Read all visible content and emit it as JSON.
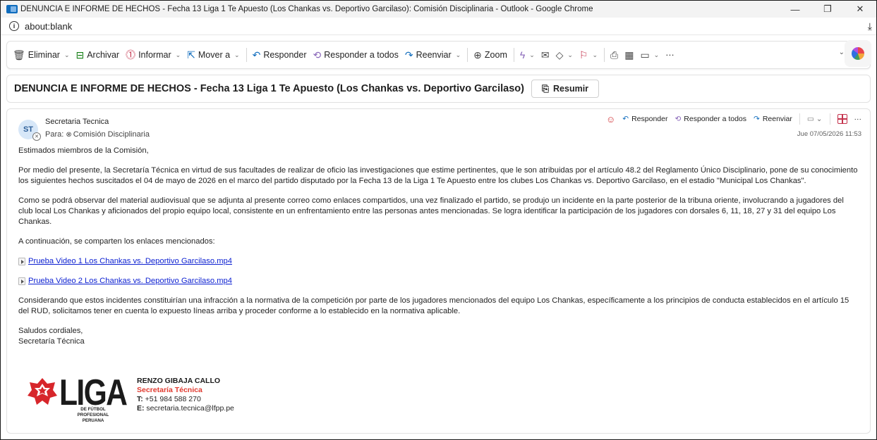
{
  "window": {
    "title": "DENUNCIA E INFORME DE HECHOS - Fecha 13 Liga 1 Te Apuesto (Los Chankas vs. Deportivo Garcilaso): Comisión Disciplinaria - Outlook - Google Chrome",
    "minimize": "—",
    "restore": "❐",
    "close": "✕"
  },
  "address_bar": {
    "url": "about:blank"
  },
  "toolbar": {
    "eliminar": "Eliminar",
    "archivar": "Archivar",
    "informar": "Informar",
    "mover": "Mover a",
    "responder": "Responder",
    "responder_todos": "Responder a todos",
    "reenviar": "Reenviar",
    "zoom": "Zoom",
    "more": "···"
  },
  "subject": {
    "text": "DENUNCIA E INFORME DE HECHOS - Fecha 13 Liga 1 Te Apuesto (Los Chankas vs. Deportivo Garcilaso)",
    "resumir": "Resumir"
  },
  "message": {
    "avatar_initials": "ST",
    "sender": "Secretaria Tecnica",
    "to_prefix": "Para:",
    "recipient": "Comisión Disciplinaria",
    "timestamp": "Jue 07/05/2026 11:53",
    "actions": {
      "responder": "Responder",
      "responder_todos": "Responder a todos",
      "reenviar": "Reenviar",
      "more": "···"
    },
    "greeting": "Estimados miembros de la Comisión,",
    "para1": "Por medio del presente, la Secretaría Técnica en virtud de sus facultades de realizar de oficio las investigaciones que estime pertinentes, que le son atribuidas por el artículo 48.2 del Reglamento Único Disciplinario, pone de su conocimiento los siguientes hechos suscitados el  04 de mayo de 2026 en el marco del partido disputado por la Fecha 13 de la Liga 1 Te Apuesto entre los clubes Los Chankas vs. Deportivo Garcilaso, en el estadio \"Municipal Los Chankas\".",
    "para2": "Como se podrá observar del material audiovisual que se adjunta al presente correo como enlaces compartidos, una vez finalizado el partido, se produjo un incidente en la parte posterior de la tribuna oriente, involucrando a jugadores del club local Los Chankas y aficionados del propio equipo local, consistente en un enfrentamiento entre las personas antes mencionadas. Se logra identificar la participación de los jugadores con dorsales 6, 11, 18, 27 y 31 del equipo Los Chankas.",
    "para3": "A continuación, se comparten los enlaces mencionados:",
    "link1": "Prueba Video 1 Los Chankas vs. Deportivo Garcilaso.mp4",
    "link2": "Prueba Video 2 Los Chankas vs. Deportivo Garcilaso.mp4",
    "para4": "Considerando que estos incidentes constituirían una infracción a la normativa de la competición por parte de los jugadores mencionados del equipo Los Chankas, específicamente a los principios de conducta establecidos en el artículo 15 del RUD, solicitamos tener en cuenta lo expuesto líneas arriba y proceder conforme a lo establecido en la normativa aplicable.",
    "closing": "Saludos cordiales,",
    "closing_signer": "Secretaría Técnica"
  },
  "signature": {
    "logo_word": "LIGA",
    "logo_sub1": "DE FÚTBOL PROFESIONAL",
    "logo_sub2": "PERUANA",
    "name": "RENZO GIBAJA CALLO",
    "role": "Secretaría Técnica",
    "phone_label": "T:",
    "phone": "+51 984 588 270",
    "email_label": "E:",
    "email": "secretaria.tecnica@lfpp.pe",
    "role_color": "#e03a2f"
  }
}
